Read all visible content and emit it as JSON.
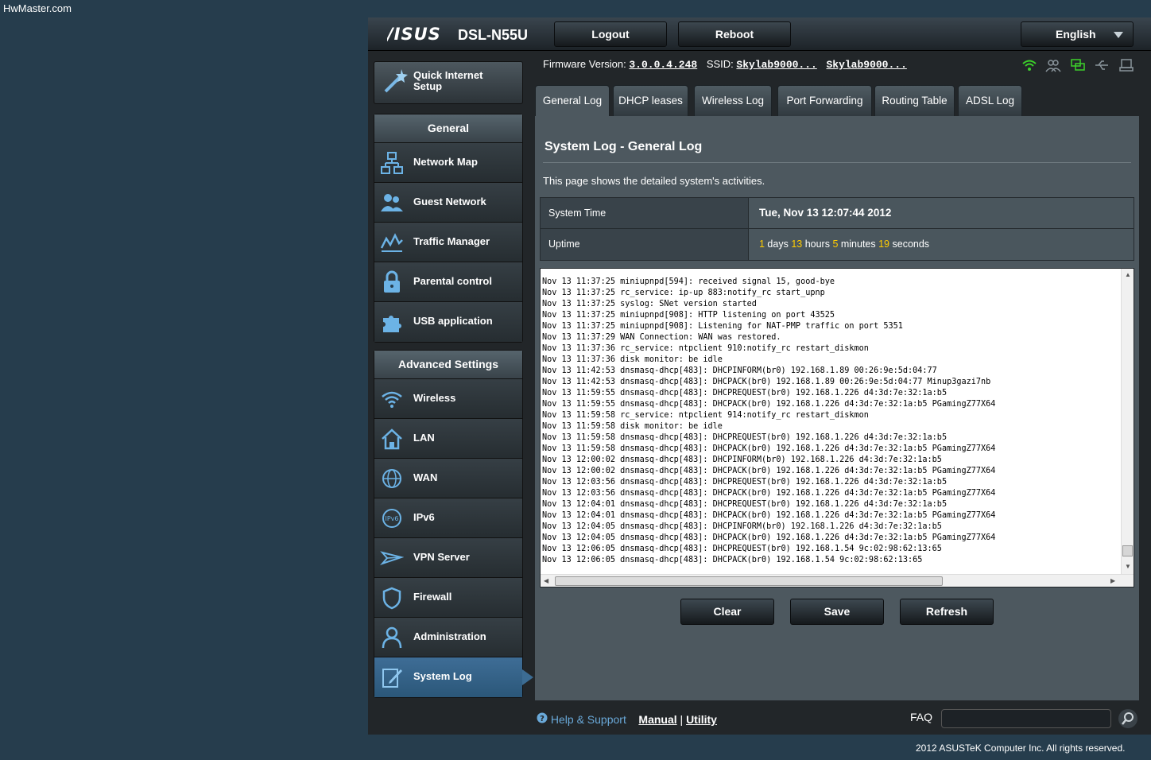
{
  "watermark": "HwMaster.com",
  "header": {
    "brand": "/ISUS",
    "model": "DSL-N55U",
    "logout_label": "Logout",
    "reboot_label": "Reboot",
    "language": "English"
  },
  "info": {
    "firmware_label": "Firmware Version:",
    "firmware_value": "3.0.0.4.248",
    "ssid_label": "SSID:",
    "ssid_1": "Skylab9000...",
    "ssid_2": "Skylab9000..."
  },
  "sidebar": {
    "quick_setup": "Quick Internet Setup",
    "general_title": "General",
    "general_items": [
      {
        "label": "Network Map",
        "icon": "network-map-icon"
      },
      {
        "label": "Guest Network",
        "icon": "guest-network-icon"
      },
      {
        "label": "Traffic Manager",
        "icon": "traffic-manager-icon"
      },
      {
        "label": "Parental control",
        "icon": "lock-icon"
      },
      {
        "label": "USB application",
        "icon": "puzzle-icon"
      }
    ],
    "advanced_title": "Advanced Settings",
    "advanced_items": [
      {
        "label": "Wireless",
        "icon": "wifi-icon"
      },
      {
        "label": "LAN",
        "icon": "home-icon"
      },
      {
        "label": "WAN",
        "icon": "globe-icon"
      },
      {
        "label": "IPv6",
        "icon": "ipv6-icon"
      },
      {
        "label": "VPN Server",
        "icon": "vpn-icon"
      },
      {
        "label": "Firewall",
        "icon": "shield-icon"
      },
      {
        "label": "Administration",
        "icon": "admin-icon"
      },
      {
        "label": "System Log",
        "icon": "syslog-icon",
        "active": true
      }
    ]
  },
  "tabs": [
    "General Log",
    "DHCP leases",
    "Wireless Log",
    "Port Forwarding",
    "Routing Table",
    "ADSL Log"
  ],
  "main": {
    "title": "System Log - General Log",
    "description": "This page shows the detailed system's activities.",
    "system_time_label": "System Time",
    "system_time_value": "Tue, Nov 13 12:07:44 2012",
    "uptime_label": "Uptime",
    "uptime": {
      "days": "1",
      "days_label": " days ",
      "hours": "13",
      "hours_label": " hours ",
      "minutes": "5",
      "minutes_label": " minutes ",
      "seconds": "19",
      "seconds_label": " seconds"
    },
    "log": "Nov 13 11:37:25 miniupnpd[594]: received signal 15, good-bye\nNov 13 11:37:25 rc_service: ip-up 883:notify_rc start_upnp\nNov 13 11:37:25 syslog: SNet version started\nNov 13 11:37:25 miniupnpd[908]: HTTP listening on port 43525\nNov 13 11:37:25 miniupnpd[908]: Listening for NAT-PMP traffic on port 5351\nNov 13 11:37:29 WAN Connection: WAN was restored.\nNov 13 11:37:36 rc_service: ntpclient 910:notify_rc restart_diskmon\nNov 13 11:37:36 disk monitor: be idle\nNov 13 11:42:53 dnsmasq-dhcp[483]: DHCPINFORM(br0) 192.168.1.89 00:26:9e:5d:04:77\nNov 13 11:42:53 dnsmasq-dhcp[483]: DHCPACK(br0) 192.168.1.89 00:26:9e:5d:04:77 Minup3gazi7nb\nNov 13 11:59:55 dnsmasq-dhcp[483]: DHCPREQUEST(br0) 192.168.1.226 d4:3d:7e:32:1a:b5\nNov 13 11:59:55 dnsmasq-dhcp[483]: DHCPACK(br0) 192.168.1.226 d4:3d:7e:32:1a:b5 PGamingZ77X64\nNov 13 11:59:58 rc_service: ntpclient 914:notify_rc restart_diskmon\nNov 13 11:59:58 disk monitor: be idle\nNov 13 11:59:58 dnsmasq-dhcp[483]: DHCPREQUEST(br0) 192.168.1.226 d4:3d:7e:32:1a:b5\nNov 13 11:59:58 dnsmasq-dhcp[483]: DHCPACK(br0) 192.168.1.226 d4:3d:7e:32:1a:b5 PGamingZ77X64\nNov 13 12:00:02 dnsmasq-dhcp[483]: DHCPINFORM(br0) 192.168.1.226 d4:3d:7e:32:1a:b5\nNov 13 12:00:02 dnsmasq-dhcp[483]: DHCPACK(br0) 192.168.1.226 d4:3d:7e:32:1a:b5 PGamingZ77X64\nNov 13 12:03:56 dnsmasq-dhcp[483]: DHCPREQUEST(br0) 192.168.1.226 d4:3d:7e:32:1a:b5\nNov 13 12:03:56 dnsmasq-dhcp[483]: DHCPACK(br0) 192.168.1.226 d4:3d:7e:32:1a:b5 PGamingZ77X64\nNov 13 12:04:01 dnsmasq-dhcp[483]: DHCPREQUEST(br0) 192.168.1.226 d4:3d:7e:32:1a:b5\nNov 13 12:04:01 dnsmasq-dhcp[483]: DHCPACK(br0) 192.168.1.226 d4:3d:7e:32:1a:b5 PGamingZ77X64\nNov 13 12:04:05 dnsmasq-dhcp[483]: DHCPINFORM(br0) 192.168.1.226 d4:3d:7e:32:1a:b5\nNov 13 12:04:05 dnsmasq-dhcp[483]: DHCPACK(br0) 192.168.1.226 d4:3d:7e:32:1a:b5 PGamingZ77X64\nNov 13 12:06:05 dnsmasq-dhcp[483]: DHCPREQUEST(br0) 192.168.1.54 9c:02:98:62:13:65\nNov 13 12:06:05 dnsmasq-dhcp[483]: DHCPACK(br0) 192.168.1.54 9c:02:98:62:13:65",
    "buttons": {
      "clear": "Clear",
      "save": "Save",
      "refresh": "Refresh"
    }
  },
  "footer": {
    "help_label": "Help & Support",
    "manual": "Manual",
    "separator": "|",
    "utility": "Utility",
    "faq": "FAQ"
  },
  "copyright": "2012 ASUSTeK Computer Inc. All rights reserved.",
  "colors": {
    "accent_blue": "#3c6c93",
    "highlight": "#ffcc00",
    "wifi_green": "#3cd12a"
  }
}
